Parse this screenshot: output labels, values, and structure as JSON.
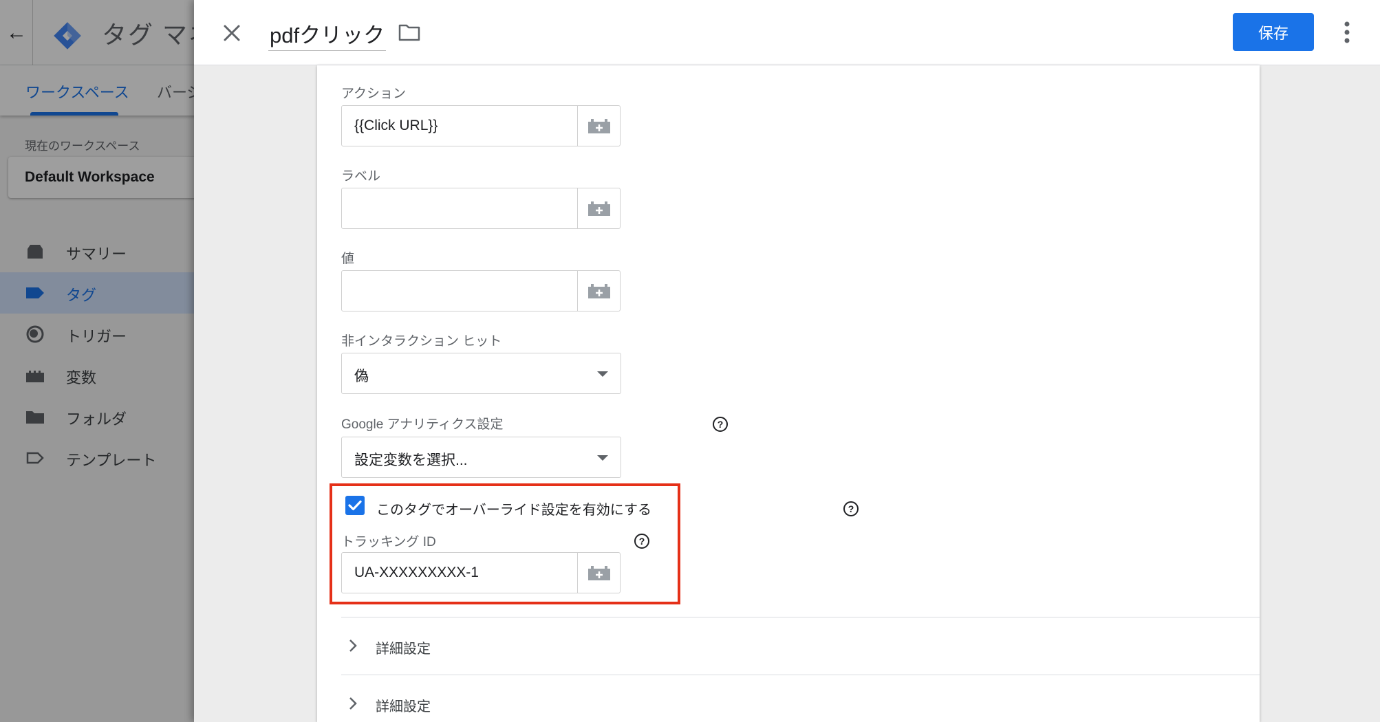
{
  "background_app": {
    "app_title": "タグ マネ",
    "tabs": [
      {
        "label": "ワークスペース",
        "active": true
      },
      {
        "label": "バージ"
      }
    ],
    "workspace_caption": "現在のワークスペース",
    "workspace_name": "Default Workspace",
    "nav": [
      {
        "label": "サマリー",
        "icon": "inbox-icon"
      },
      {
        "label": "タグ",
        "icon": "tag-icon",
        "active": true
      },
      {
        "label": "トリガー",
        "icon": "trigger-icon"
      },
      {
        "label": "変数",
        "icon": "variable-icon"
      },
      {
        "label": "フォルダ",
        "icon": "folder-icon"
      },
      {
        "label": "テンプレート",
        "icon": "template-icon"
      }
    ]
  },
  "editor": {
    "tag_name": "pdfクリック",
    "save_label": "保存",
    "fields": {
      "action": {
        "label": "アクション",
        "value": "{{Click URL}}"
      },
      "label": {
        "label": "ラベル",
        "value": ""
      },
      "value": {
        "label": "値",
        "value": ""
      },
      "non_interaction": {
        "label": "非インタラクション ヒット",
        "selected": "偽"
      },
      "ga_settings": {
        "label": "Google アナリティクス設定",
        "selected": "設定変数を選択..."
      }
    },
    "override": {
      "checked": true,
      "label": "このタグでオーバーライド設定を有効にする",
      "tracking_id_label": "トラッキング ID",
      "tracking_id_value": "UA-XXXXXXXXX-1"
    },
    "sections": [
      {
        "label": "詳細設定"
      },
      {
        "label": "詳細設定"
      }
    ]
  },
  "colors": {
    "accent": "#1a73e8",
    "highlight_box": "#e53018",
    "overlay": "rgba(0,0,0,0.38)"
  }
}
